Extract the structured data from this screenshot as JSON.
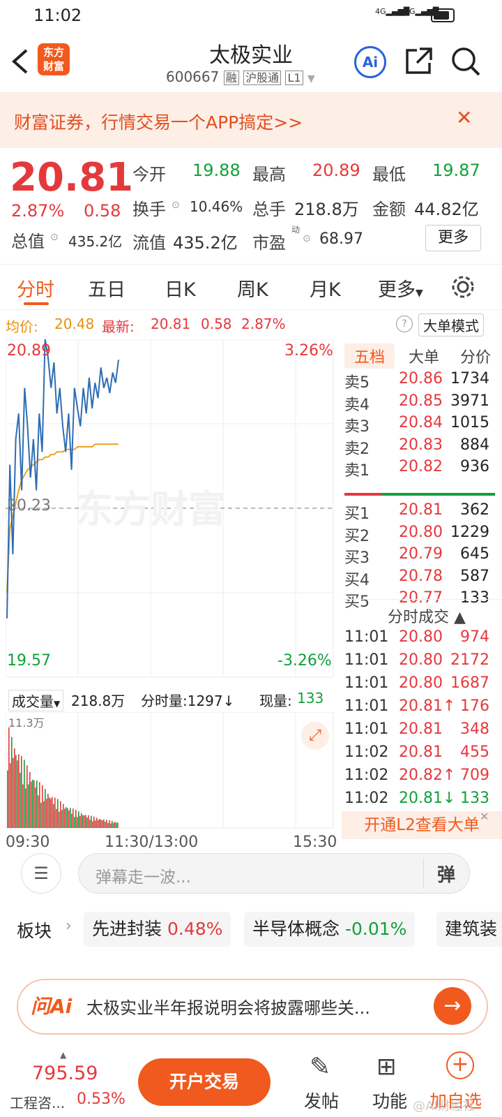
{
  "status": {
    "time": "11:02",
    "signal1": "4G",
    "signal2": "4G"
  },
  "header": {
    "title": "太极实业",
    "code": "600667",
    "tags": [
      "融",
      "沪股通",
      "L1"
    ],
    "logo_text": "东方财富",
    "ai_label": "Ai"
  },
  "banner": {
    "text": "财富证券，行情交易一个APP搞定>>",
    "close": "✕"
  },
  "quote": {
    "price": "20.81",
    "change_pct": "2.87%",
    "change": "0.58",
    "open_label": "今开",
    "open": "19.88",
    "high_label": "最高",
    "high": "20.89",
    "low_label": "最低",
    "low": "19.87",
    "turnover_label": "换手",
    "turnover": "10.46%",
    "volume_label": "总手",
    "volume": "218.8万",
    "amount_label": "金额",
    "amount": "44.82亿",
    "mktcap_label": "总值",
    "mktcap": "435.2亿",
    "float_label": "流值",
    "float": "435.2亿",
    "pe_label": "市盈",
    "pe_sup": "动",
    "pe": "68.97",
    "more": "更多"
  },
  "tabs": [
    "分时",
    "五日",
    "日K",
    "周K",
    "月K",
    "更多"
  ],
  "avgbar": {
    "avg_label": "均价:",
    "avg": "20.48",
    "latest_label": "最新:",
    "latest": "20.81",
    "chg": "0.58",
    "pct": "2.87%",
    "mode": "大单模式"
  },
  "chart_labels": {
    "top_price": "20.89",
    "top_pct": "3.26%",
    "mid_price": "20.23",
    "bot_price": "19.57",
    "bot_pct": "-3.26%",
    "watermark": "东方财富"
  },
  "volbar": {
    "label": "成交量",
    "total": "218.8万",
    "tick_label": "分时量:1297↓",
    "now_label": "现量:",
    "now": "133",
    "max": "11.3万"
  },
  "time_axis": {
    "start": "09:30",
    "mid": "11:30/13:00",
    "end": "15:30"
  },
  "book": {
    "tabs": [
      "五档",
      "大单",
      "分价"
    ],
    "asks": [
      {
        "label": "卖5",
        "price": "20.86",
        "vol": "1734"
      },
      {
        "label": "卖4",
        "price": "20.85",
        "vol": "3971"
      },
      {
        "label": "卖3",
        "price": "20.84",
        "vol": "1015"
      },
      {
        "label": "卖2",
        "price": "20.83",
        "vol": "884"
      },
      {
        "label": "卖1",
        "price": "20.82",
        "vol": "936"
      }
    ],
    "bids": [
      {
        "label": "买1",
        "price": "20.81",
        "vol": "362"
      },
      {
        "label": "买2",
        "price": "20.80",
        "vol": "1229"
      },
      {
        "label": "买3",
        "price": "20.79",
        "vol": "645"
      },
      {
        "label": "买4",
        "price": "20.78",
        "vol": "587"
      },
      {
        "label": "买5",
        "price": "20.77",
        "vol": "133"
      }
    ],
    "trades_title": "分时成交",
    "trades": [
      {
        "time": "11:01",
        "price": "20.80",
        "vol": "974",
        "color": "red"
      },
      {
        "time": "11:01",
        "price": "20.80",
        "vol": "2172",
        "color": "red"
      },
      {
        "time": "11:01",
        "price": "20.80",
        "vol": "1687",
        "color": "red"
      },
      {
        "time": "11:01",
        "price": "20.81↑",
        "vol": "176",
        "color": "red"
      },
      {
        "time": "11:01",
        "price": "20.81",
        "vol": "348",
        "color": "red"
      },
      {
        "time": "11:02",
        "price": "20.81",
        "vol": "455",
        "color": "red"
      },
      {
        "time": "11:02",
        "price": "20.82↑",
        "vol": "709",
        "color": "red"
      },
      {
        "time": "11:02",
        "price": "20.81↓",
        "vol": "133",
        "color": "green"
      }
    ],
    "l2": "开通L2查看大单"
  },
  "danmu": {
    "placeholder": "弹幕走一波...",
    "btn": "弹"
  },
  "sector": {
    "label": "板块",
    "chips": [
      {
        "name": "先进封装",
        "pct": "0.48%",
        "color": "red"
      },
      {
        "name": "半导体概念",
        "pct": "-0.01%",
        "color": "green"
      },
      {
        "name": "建筑装",
        "pct": "",
        "color": "red"
      }
    ]
  },
  "ai": {
    "logo": "问Ai",
    "text": "太极实业半年报说明会将披露哪些关..."
  },
  "bottom": {
    "index_value": "795.59",
    "index_name": "工程咨...",
    "index_pct": "0.53%",
    "trade": "开户交易",
    "post": "发帖",
    "func": "功能",
    "watch": "加自选",
    "watermark": "@AI财经社"
  },
  "colors": {
    "red": "#e4393c",
    "green": "#11a03c",
    "orange": "#f05a1e",
    "avg_line": "#f0a020",
    "price_line": "#2e6db4"
  },
  "chart_data": {
    "type": "line",
    "title": "",
    "ylim": [
      19.57,
      20.89
    ],
    "prev_close": 20.23,
    "series": [
      {
        "values": [
          19.8,
          20.4,
          20.05,
          20.5,
          20.6,
          20.3,
          20.7,
          20.55,
          20.35,
          20.5,
          20.3,
          20.6,
          20.45,
          20.89,
          20.82,
          20.7,
          20.8,
          20.6,
          20.7,
          20.55,
          20.45,
          20.6,
          20.38,
          20.7,
          20.62,
          20.55,
          20.7,
          20.6,
          20.74,
          20.62,
          20.72,
          20.66,
          20.78,
          20.7,
          20.74,
          20.68,
          20.76,
          20.72,
          20.81
        ]
      },
      {
        "values": [
          19.9,
          20.15,
          20.2,
          20.25,
          20.3,
          20.34,
          20.36,
          20.38,
          20.39,
          20.4,
          20.41,
          20.42,
          20.42,
          20.43,
          20.43,
          20.44,
          20.44,
          20.45,
          20.45,
          20.45,
          20.46,
          20.46,
          20.46,
          20.46,
          20.47,
          20.47,
          20.47,
          20.47,
          20.47,
          20.47,
          20.48,
          20.48,
          20.48,
          20.48,
          20.48,
          20.48,
          20.48,
          20.48,
          20.48
        ]
      }
    ]
  }
}
